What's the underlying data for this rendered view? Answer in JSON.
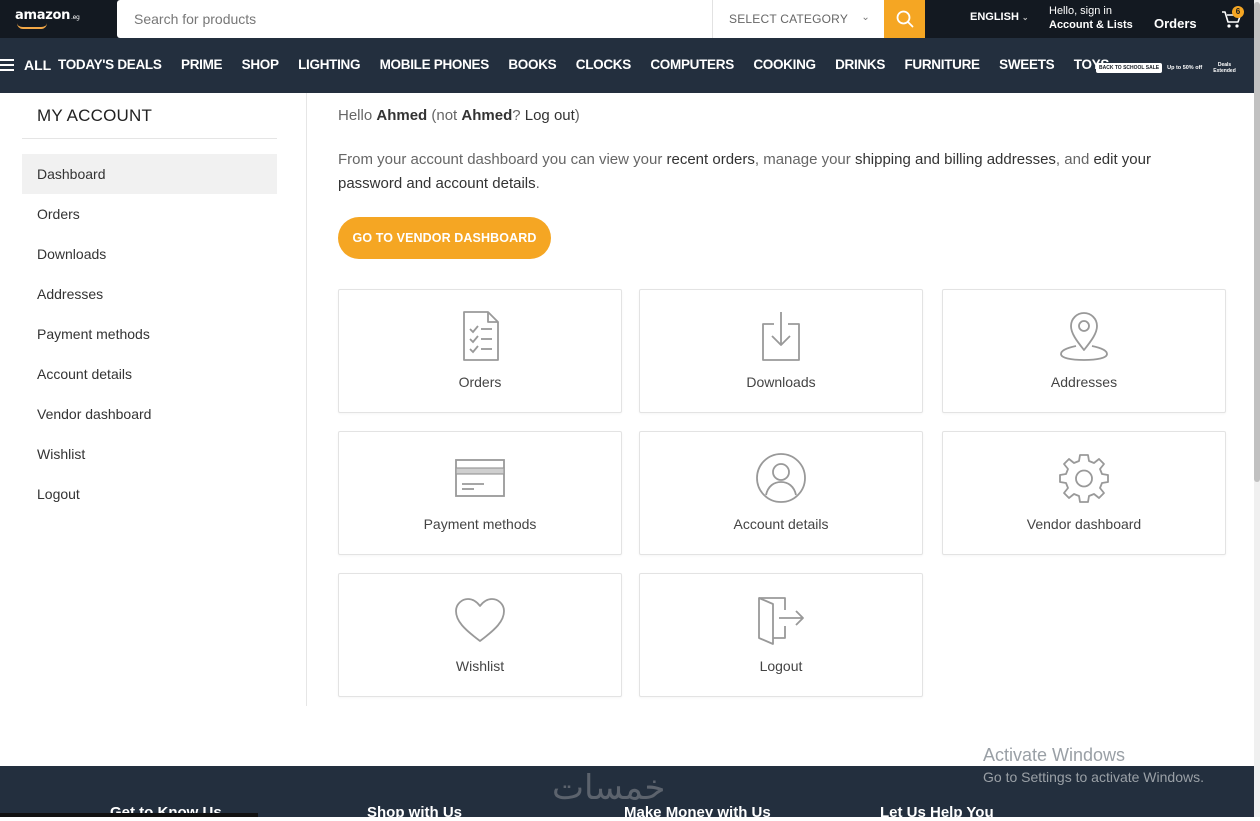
{
  "header": {
    "logo_text": "amazon",
    "logo_suffix": ".eg",
    "search_placeholder": "Search for products",
    "category_label": "SELECT CATEGORY",
    "language": "ENGLISH",
    "signin_line1": "Hello, sign in",
    "signin_line2": "Account & Lists",
    "orders": "Orders",
    "cart_count": "6",
    "accent_color": "#f5a623"
  },
  "nav": {
    "all_label": "ALL",
    "items": [
      "TODAY'S DEALS",
      "PRIME",
      "SHOP",
      "LIGHTING",
      "MOBILE PHONES",
      "BOOKS",
      "CLOCKS",
      "COMPUTERS",
      "COOKING",
      "DRINKS",
      "FURNITURE",
      "SWEETS",
      "TOYS"
    ],
    "promo_tag": "BACK TO SCHOOL SALE",
    "promo_text": "Up to 50% off",
    "promo_text2a": "Deals",
    "promo_text2b": "Extended"
  },
  "sidebar": {
    "title": "MY ACCOUNT",
    "items": [
      {
        "label": "Dashboard",
        "active": true
      },
      {
        "label": "Orders"
      },
      {
        "label": "Downloads"
      },
      {
        "label": "Addresses"
      },
      {
        "label": "Payment methods"
      },
      {
        "label": "Account details"
      },
      {
        "label": "Vendor dashboard"
      },
      {
        "label": "Wishlist"
      },
      {
        "label": "Logout"
      }
    ]
  },
  "main": {
    "hello_prefix": "Hello ",
    "user_name": "Ahmed",
    "hello_mid": " (not ",
    "hello_q": "? ",
    "logout_link": "Log out",
    "hello_end": ")",
    "intro_1": "From your account dashboard you can view your ",
    "intro_link1": "recent orders",
    "intro_2": ", manage your ",
    "intro_link2": "shipping and billing addresses",
    "intro_3": ", and ",
    "intro_link3": "edit your password and account details",
    "intro_4": ".",
    "vendor_button": "GO TO VENDOR DASHBOARD",
    "cards": [
      {
        "label": "Orders",
        "icon": "orders-icon"
      },
      {
        "label": "Downloads",
        "icon": "downloads-icon"
      },
      {
        "label": "Addresses",
        "icon": "location-pin-icon"
      },
      {
        "label": "Payment methods",
        "icon": "credit-card-icon"
      },
      {
        "label": "Account details",
        "icon": "user-circle-icon"
      },
      {
        "label": "Vendor dashboard",
        "icon": "gear-icon"
      },
      {
        "label": "Wishlist",
        "icon": "heart-icon"
      },
      {
        "label": "Logout",
        "icon": "logout-door-icon"
      }
    ]
  },
  "footer": {
    "col1": "Get to Know Us",
    "col2": "Shop with Us",
    "col3": "Make Money with Us",
    "col4": "Let Us Help You"
  },
  "overlay": {
    "activate_title": "Activate Windows",
    "activate_sub": "Go to Settings to activate Windows.",
    "watermark_logo": "خمسات"
  }
}
